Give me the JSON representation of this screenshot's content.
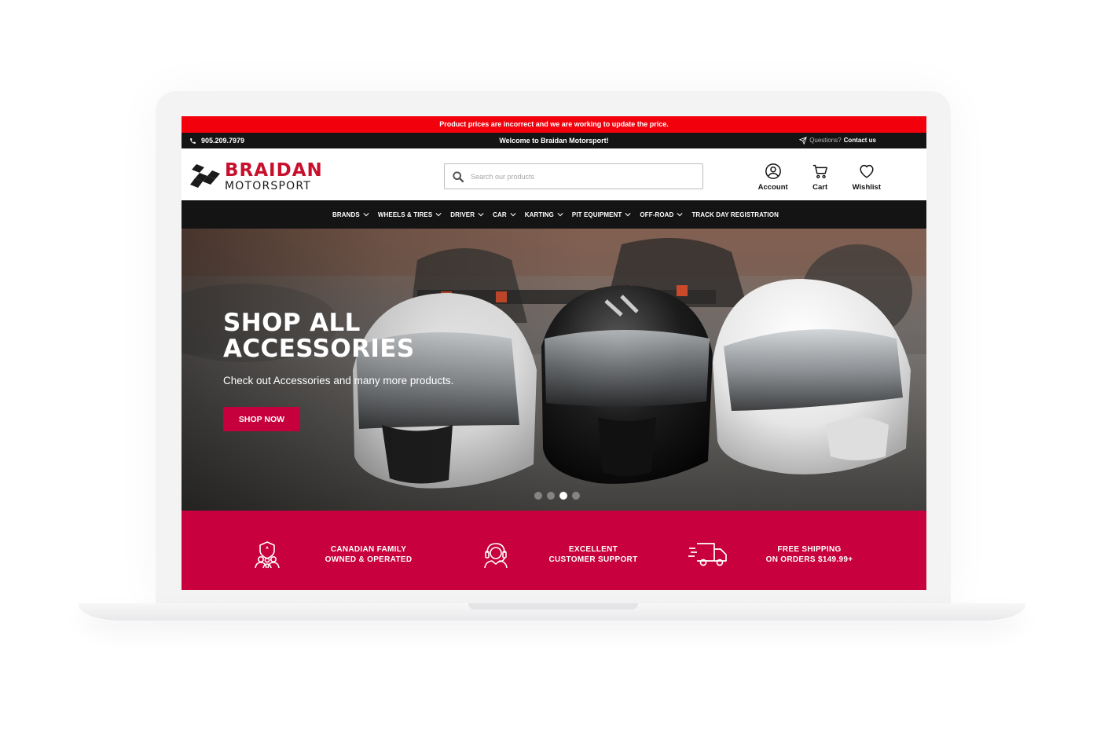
{
  "notice": "Product prices are incorrect and we are working to update the price.",
  "topbar": {
    "phone": "905.209.7979",
    "welcome": "Welcome to Braidan Motorsport!",
    "questions": "Questions?",
    "contact": "Contact us"
  },
  "logo": {
    "line1": "BRAIDAN",
    "line2": "MOTORSPORT"
  },
  "search": {
    "placeholder": "Search our products",
    "value": ""
  },
  "actions": {
    "account": "Account",
    "cart": "Cart",
    "wishlist": "Wishlist"
  },
  "nav": [
    {
      "label": "BRANDS",
      "dropdown": true
    },
    {
      "label": "WHEELS & TIRES",
      "dropdown": true
    },
    {
      "label": "DRIVER",
      "dropdown": true
    },
    {
      "label": "CAR",
      "dropdown": true
    },
    {
      "label": "KARTING",
      "dropdown": true
    },
    {
      "label": "PIT EQUIPMENT",
      "dropdown": true
    },
    {
      "label": "OFF-ROAD",
      "dropdown": true
    },
    {
      "label": "TRACK DAY REGISTRATION",
      "dropdown": false
    }
  ],
  "hero": {
    "title": "SHOP ALL\nACCESSORIES",
    "subtitle": "Check out Accessories and many more products.",
    "button": "SHOP NOW",
    "slides": 4,
    "active_slide": 3
  },
  "features": [
    {
      "icon": "family-icon",
      "text": "CANADIAN FAMILY\nOWNED & OPERATED"
    },
    {
      "icon": "support-agent-icon",
      "text": "EXCELLENT\nCUSTOMER SUPPORT"
    },
    {
      "icon": "delivery-truck-icon",
      "text": "FREE SHIPPING\nON ORDERS $149.99+"
    }
  ],
  "colors": {
    "notice_red": "#f2000c",
    "brand_red": "#c8102e",
    "feature_band": "#c8003d",
    "dark_bar": "#141414"
  }
}
